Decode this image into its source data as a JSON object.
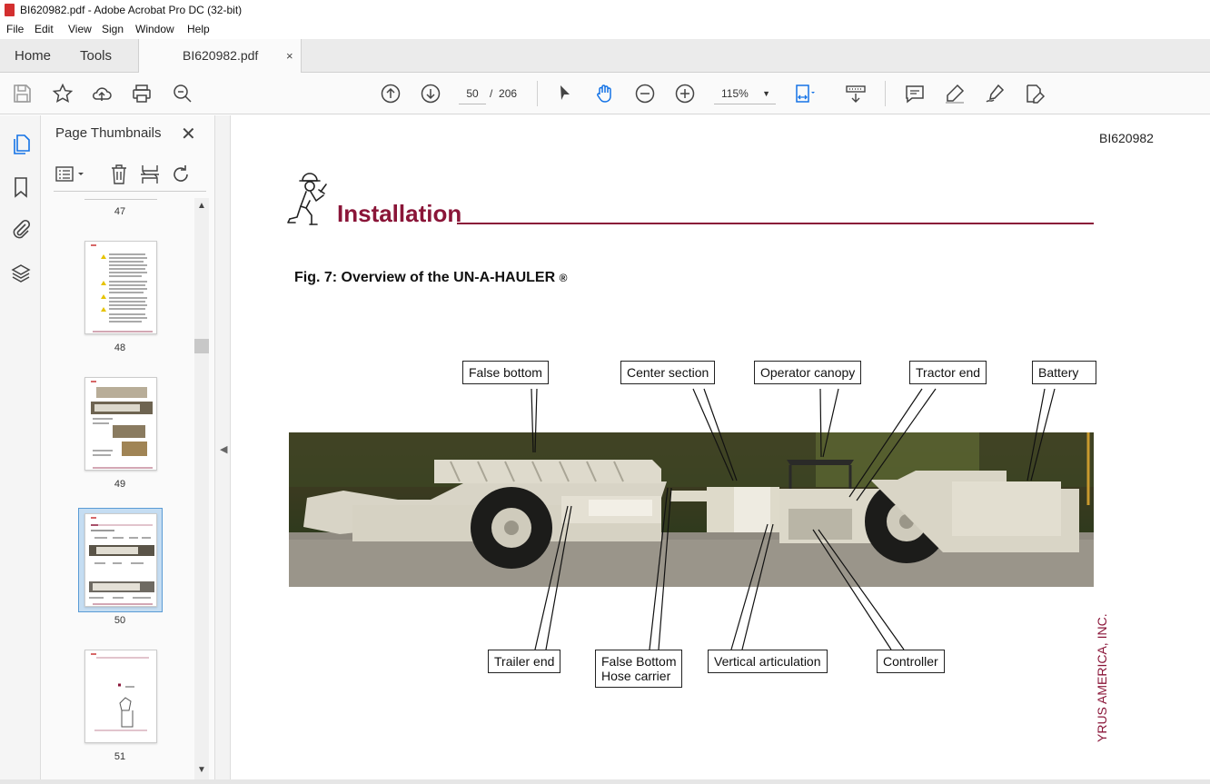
{
  "window": {
    "title": "BI620982.pdf - Adobe Acrobat Pro DC (32-bit)"
  },
  "menu": [
    "File",
    "Edit",
    "View",
    "Sign",
    "Window",
    "Help"
  ],
  "tabs": {
    "home": "Home",
    "tools": "Tools",
    "doc": "BI620982.pdf",
    "close": "×"
  },
  "toolbar": {
    "page_current": "50",
    "page_sep": "/",
    "page_total": "206",
    "zoom": "115%"
  },
  "panel": {
    "title": "Page Thumbnails",
    "close": "✕",
    "thumbs": [
      {
        "num": "47"
      },
      {
        "num": "48"
      },
      {
        "num": "49"
      },
      {
        "num": "50",
        "selected": true
      },
      {
        "num": "51"
      }
    ]
  },
  "document": {
    "doc_id": "BI620982",
    "section_title": "Installation",
    "figure_caption": "Fig. 7: Overview of the UN-A-HAULER",
    "figure_caption_mark": "®",
    "callouts_top": [
      "False bottom",
      "Center section",
      "Operator canopy",
      "Tractor end",
      "Battery"
    ],
    "callouts_bottom": [
      "Trailer end",
      "False Bottom",
      "Hose carrier",
      "Vertical articulation",
      "Controller"
    ],
    "side_text": "YRUS AMERICA, INC."
  },
  "colors": {
    "accent": "#8a1538",
    "selected_thumb": "#c5ddf2"
  }
}
